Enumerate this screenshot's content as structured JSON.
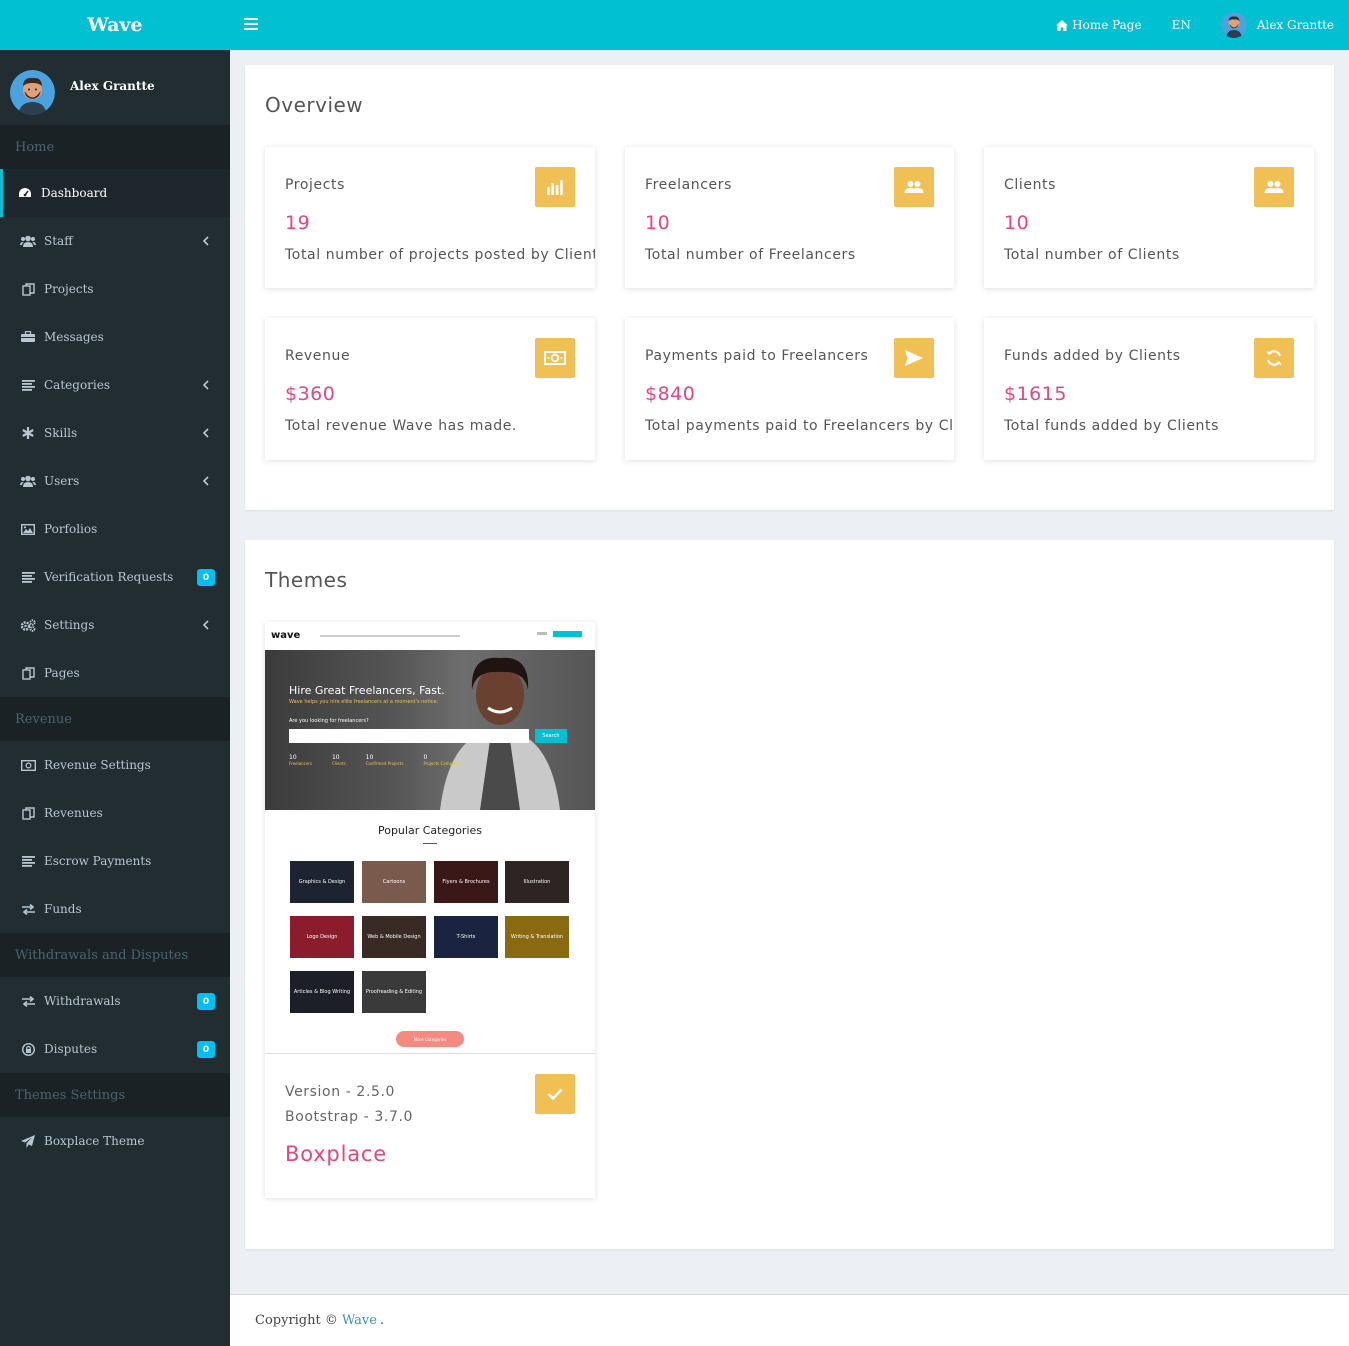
{
  "brand": "Wave",
  "topnav": {
    "home": "Home Page",
    "lang": "EN",
    "user": "Alex Grantte"
  },
  "sidebar": {
    "user_name": "Alex Grantte",
    "sections": {
      "home": "Home",
      "revenue": "Revenue",
      "withdrawals": "Withdrawals and Disputes",
      "themes": "Themes Settings"
    },
    "items": [
      {
        "label": "Dashboard",
        "icon": "dashboard-icon"
      },
      {
        "label": "Staff",
        "icon": "users-icon"
      },
      {
        "label": "Projects",
        "icon": "copy-icon"
      },
      {
        "label": "Messages",
        "icon": "briefcase-icon"
      },
      {
        "label": "Categories",
        "icon": "list-icon"
      },
      {
        "label": "Skills",
        "icon": "asterisk-icon"
      },
      {
        "label": "Users",
        "icon": "users-icon"
      },
      {
        "label": "Porfolios",
        "icon": "image-icon"
      },
      {
        "label": "Verification Requests",
        "icon": "list-icon",
        "badge": "0"
      },
      {
        "label": "Settings",
        "icon": "gears-icon"
      },
      {
        "label": "Pages",
        "icon": "copy-icon"
      },
      {
        "label": "Revenue Settings",
        "icon": "money-icon"
      },
      {
        "label": "Revenues",
        "icon": "copy-icon"
      },
      {
        "label": "Escrow Payments",
        "icon": "list-icon"
      },
      {
        "label": "Funds",
        "icon": "exchange-icon"
      },
      {
        "label": "Withdrawals",
        "icon": "exchange-icon",
        "badge": "0"
      },
      {
        "label": "Disputes",
        "icon": "lock-icon",
        "badge": "0"
      },
      {
        "label": "Boxplace Theme",
        "icon": "paper-plane-icon"
      }
    ]
  },
  "overview": {
    "title": "Overview",
    "cards": [
      {
        "label": "Projects",
        "value": "19",
        "desc": "Total number of projects posted by Clients",
        "icon": "bar-chart-icon"
      },
      {
        "label": "Freelancers",
        "value": "10",
        "desc": "Total number of Freelancers",
        "icon": "people-icon"
      },
      {
        "label": "Clients",
        "value": "10",
        "desc": "Total number of Clients",
        "icon": "people-icon"
      },
      {
        "label": "Revenue",
        "value": "$360",
        "desc": "Total revenue Wave has made.",
        "icon": "money-icon"
      },
      {
        "label": "Payments paid to Freelancers",
        "value": "$840",
        "desc": "Total payments paid to Freelancers by Clients",
        "icon": "send-icon"
      },
      {
        "label": "Funds added by Clients",
        "value": "$1615",
        "desc": "Total funds added by Clients",
        "icon": "refresh-icon"
      }
    ]
  },
  "themes": {
    "title": "Themes",
    "theme": {
      "version": "Version - 2.5.0",
      "bootstrap": "Bootstrap - 3.7.0",
      "name": "Boxplace",
      "preview": {
        "logo": "wave",
        "headline": "Hire Great Freelancers, Fast.",
        "tagline": "Wave helps you hire elite freelancers at a moment's notice.",
        "question": "Are you looking for freelancers?",
        "search_btn": "Search",
        "stats": [
          {
            "value": "10",
            "label": "Freelancers"
          },
          {
            "value": "10",
            "label": "Clients"
          },
          {
            "value": "10",
            "label": "Confirmed Projects"
          },
          {
            "value": "0",
            "label": "Projects Completed"
          }
        ],
        "popular": "Popular Categories",
        "categories": [
          "Graphics & Design",
          "Cartoons",
          "Flyers & Brochures",
          "Illustration",
          "Logo Design",
          "Web & Mobile Design",
          "T-Shirts",
          "Writing & Translation",
          "Articles & Blog Writing",
          "Proofreading & Editing"
        ],
        "more": "More Categories"
      }
    }
  },
  "footer": {
    "copyright": "Copyright ©",
    "link": "Wave",
    "end": "."
  }
}
